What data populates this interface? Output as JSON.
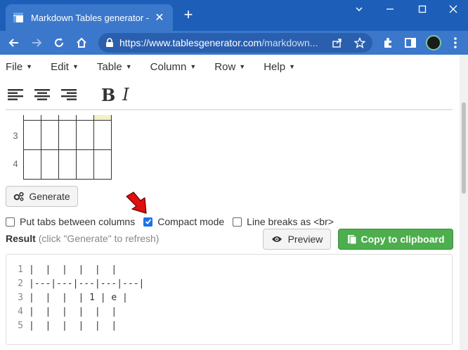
{
  "browser": {
    "tab_title": "Markdown Tables generator - Tab",
    "url_host": "https://www.tablesgenerator.com",
    "url_path": "/markdown..."
  },
  "menu": [
    "File",
    "Edit",
    "Table",
    "Column",
    "Row",
    "Help"
  ],
  "format": {
    "bold": "B",
    "italic": "I"
  },
  "grid": {
    "row_labels": [
      "3",
      "4"
    ]
  },
  "generate_label": "Generate",
  "options": [
    {
      "label": "Put tabs between columns",
      "checked": false
    },
    {
      "label": "Compact mode",
      "checked": true
    },
    {
      "label": "Line breaks as <br>",
      "checked": false
    }
  ],
  "result": {
    "label": "Result",
    "hint": "(click \"Generate\" to refresh)"
  },
  "preview_label": "Preview",
  "copy_label": "Copy to clipboard",
  "code_lines": [
    {
      "n": "1",
      "text": "|  |  |  |  |  |"
    },
    {
      "n": "2",
      "text": "|---|---|---|---|---|"
    },
    {
      "n": "3",
      "text": "|  |  |  | 1 | e |"
    },
    {
      "n": "4",
      "text": "|  |  |  |  |  |"
    },
    {
      "n": "5",
      "text": "|  |  |  |  |  |"
    }
  ],
  "colors": {
    "chrome": "#1d5fb8",
    "toolbar": "#3b78cc",
    "copy_green": "#4cae4c",
    "arrow_red": "#e01010"
  }
}
